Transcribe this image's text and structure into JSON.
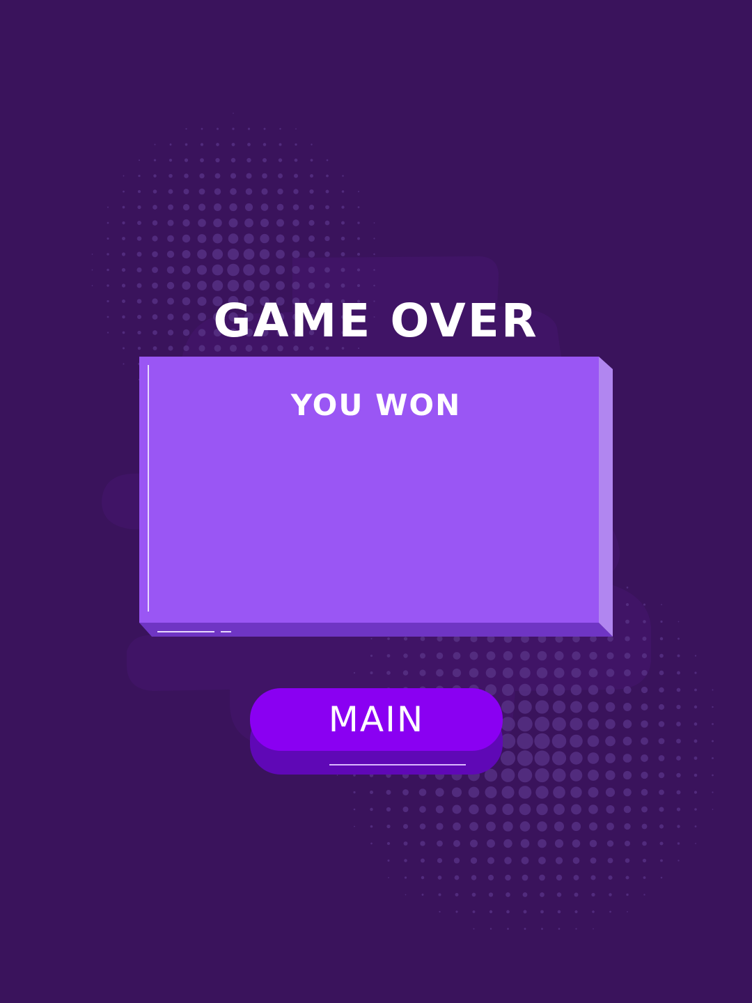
{
  "screen": {
    "title": "GAME OVER",
    "result_text": "YOU WON",
    "main_button_label": "MAIN"
  },
  "colors": {
    "background": "#3a135c",
    "panel_face": "#9a56f4",
    "panel_side": "#b186f0",
    "panel_bottom": "#6f35c4",
    "button_face": "#8a00f2",
    "button_base": "#5f08b6",
    "text": "#ffffff"
  },
  "decor": {
    "dot-pattern": "halftone-dots",
    "blobs": "soft-purple-shapes"
  }
}
